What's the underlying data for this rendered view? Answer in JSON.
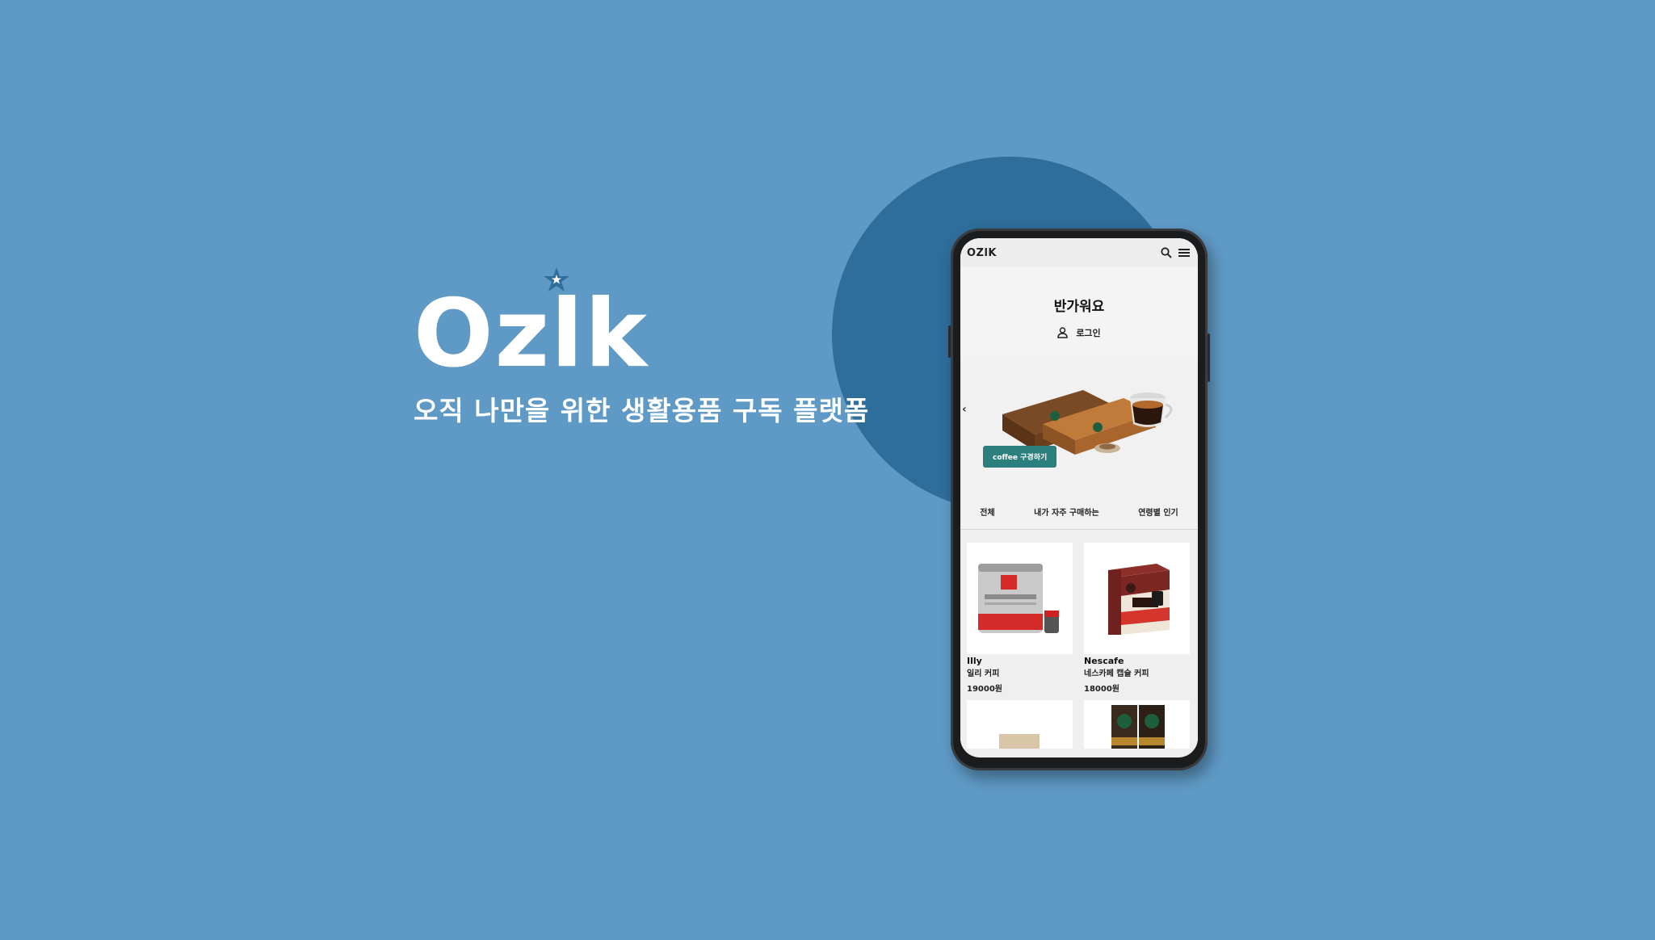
{
  "brand": {
    "logo": "Ozlk",
    "tagline": "오직 나만을 위한 생활용품 구독 플랫폼"
  },
  "app": {
    "logo": "OZlK",
    "welcome_title": "반가워요",
    "login_label": "로그인",
    "banner_button": "coffee 구경하기",
    "tabs": [
      "전체",
      "내가 자주 구매하는",
      "연령별 인기"
    ],
    "products": [
      {
        "brand": "Illy",
        "name": "일리 커피",
        "price": "19000원"
      },
      {
        "brand": "Nescafe",
        "name": "네스카페 캡슐 커피",
        "price": "18000원"
      }
    ]
  },
  "colors": {
    "background": "#5f9ac6",
    "circle": "#2f6d9a",
    "accent_button": "#2b7f7d"
  }
}
